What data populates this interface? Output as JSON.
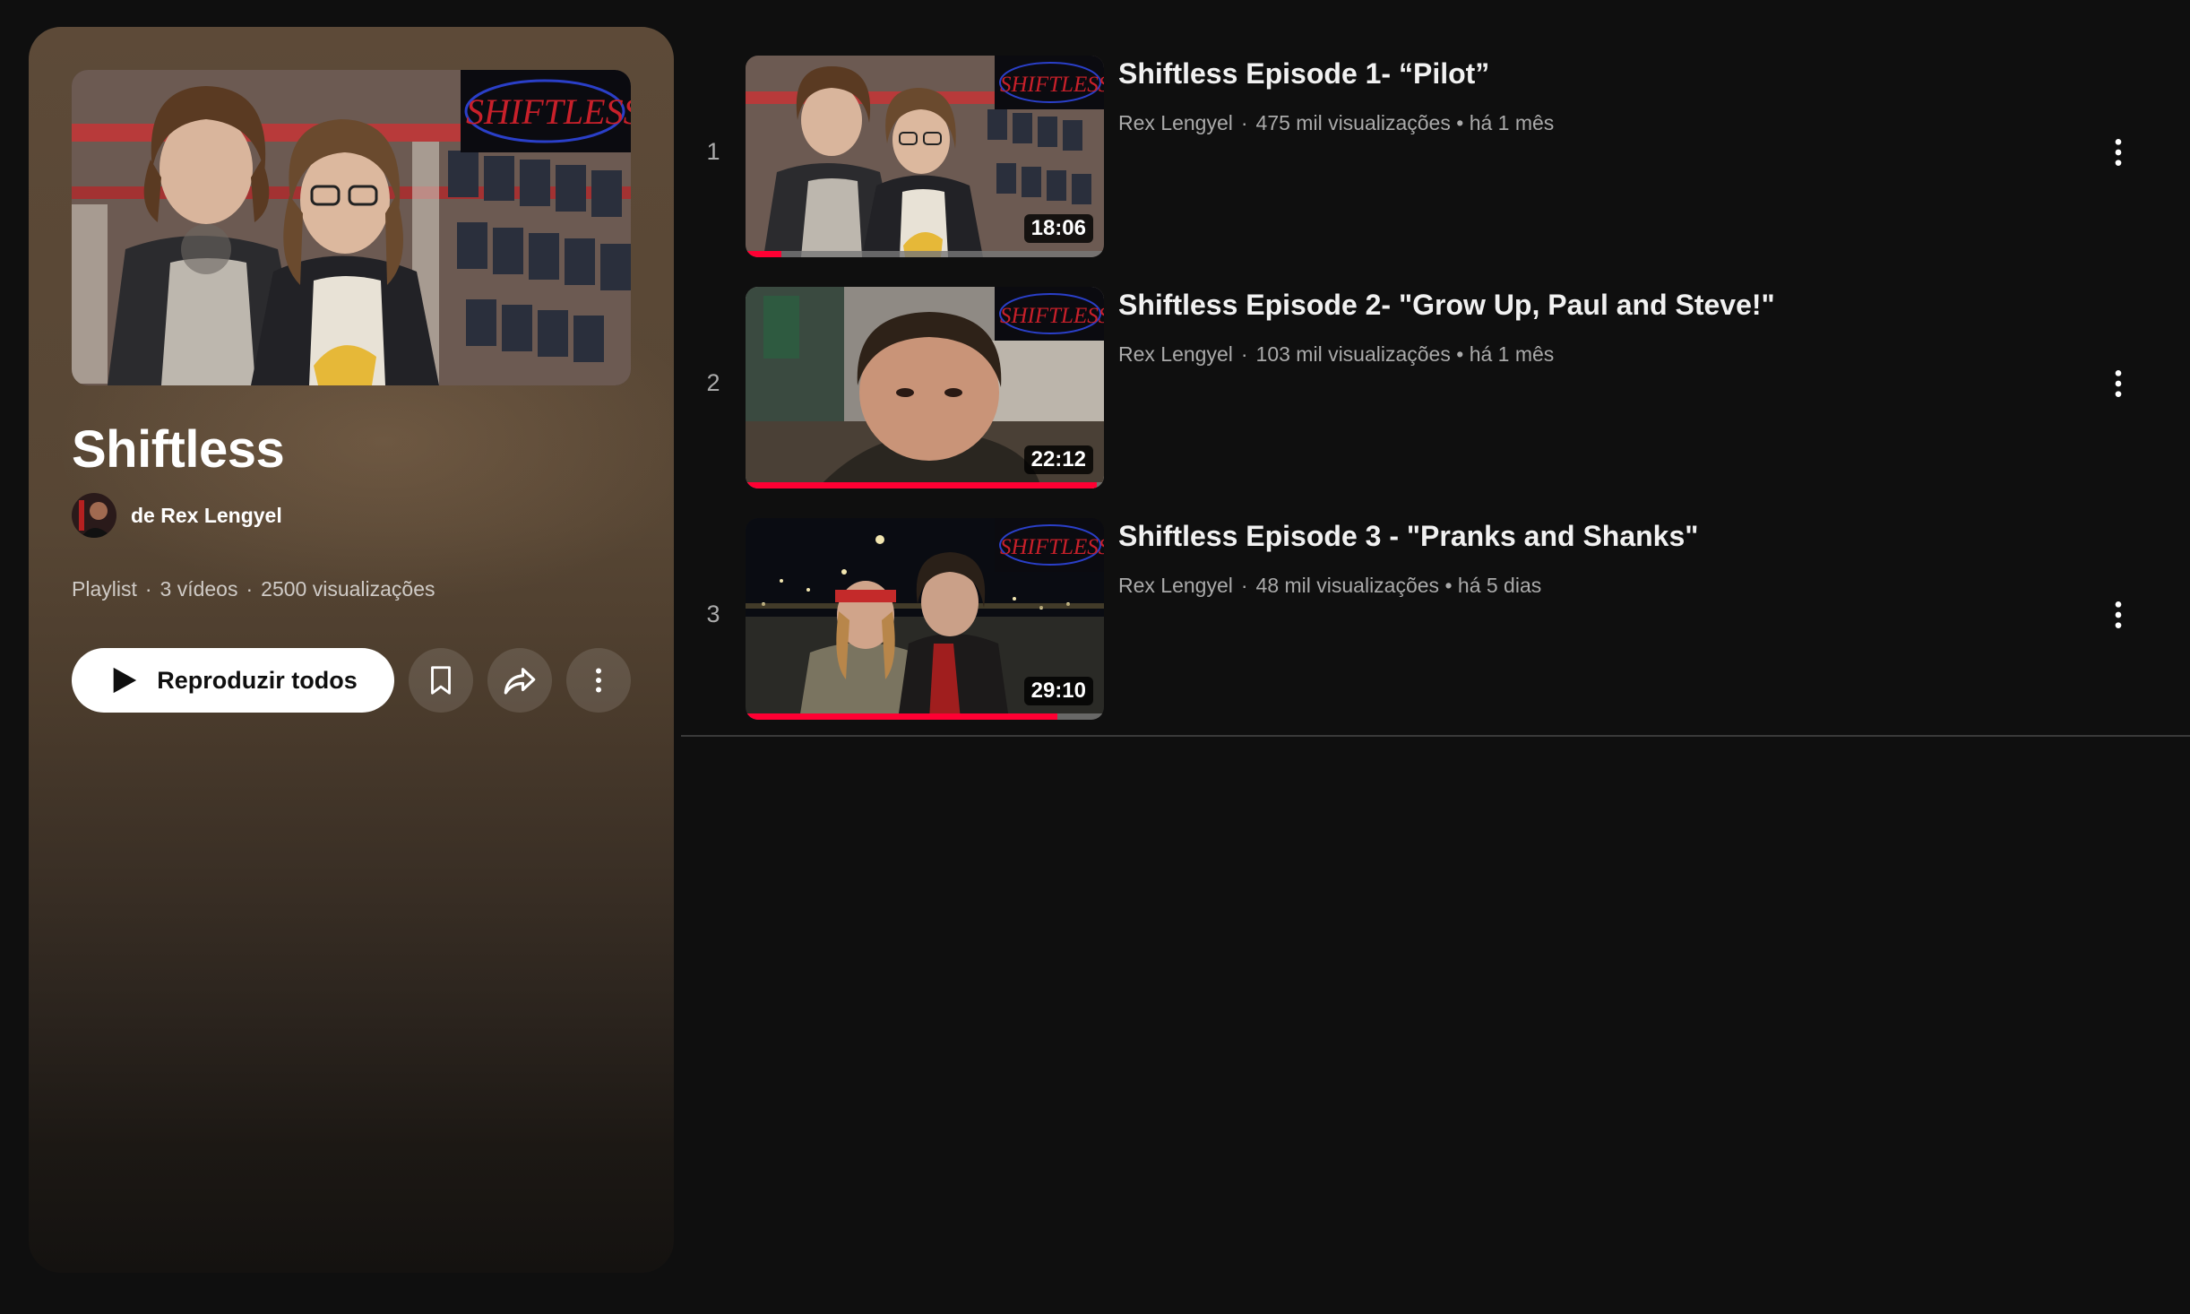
{
  "playlist": {
    "title": "Shiftless",
    "owner": "de Rex Lengyel",
    "meta": [
      "Playlist",
      "3 vídeos",
      "2500 visualizações"
    ],
    "play_all_label": "Reproduzir todos",
    "thumbnail_logo": "SHIFTLESS"
  },
  "icons": {
    "play": "play-icon",
    "save": "bookmark-icon",
    "share": "share-icon",
    "more": "more-vert-icon"
  },
  "colors": {
    "background": "#0f0f0f",
    "panel_top": "#5d4a38",
    "progress": "#ff0033",
    "logo_red": "#c8202a",
    "logo_blue": "#2a3fc8"
  },
  "videos": [
    {
      "index": "1",
      "title": "Shiftless Episode 1- “Pilot”",
      "channel": "Rex Lengyel",
      "views": "475 mil visualizações",
      "age": "há 1 mês",
      "duration": "18:06",
      "watched_fraction": 0.1,
      "logo": "SHIFTLESS"
    },
    {
      "index": "2",
      "title": "Shiftless Episode 2- \"Grow Up, Paul and Steve!\"",
      "channel": "Rex Lengyel",
      "views": "103 mil visualizações",
      "age": "há 1 mês",
      "duration": "22:12",
      "watched_fraction": 0.98,
      "logo": "SHIFTLESS"
    },
    {
      "index": "3",
      "title": "Shiftless Episode 3 - \"Pranks and Shanks\"",
      "channel": "Rex Lengyel",
      "views": "48 mil visualizações",
      "age": "há 5 dias",
      "duration": "29:10",
      "watched_fraction": 0.87,
      "logo": "SHIFTLESS"
    }
  ]
}
